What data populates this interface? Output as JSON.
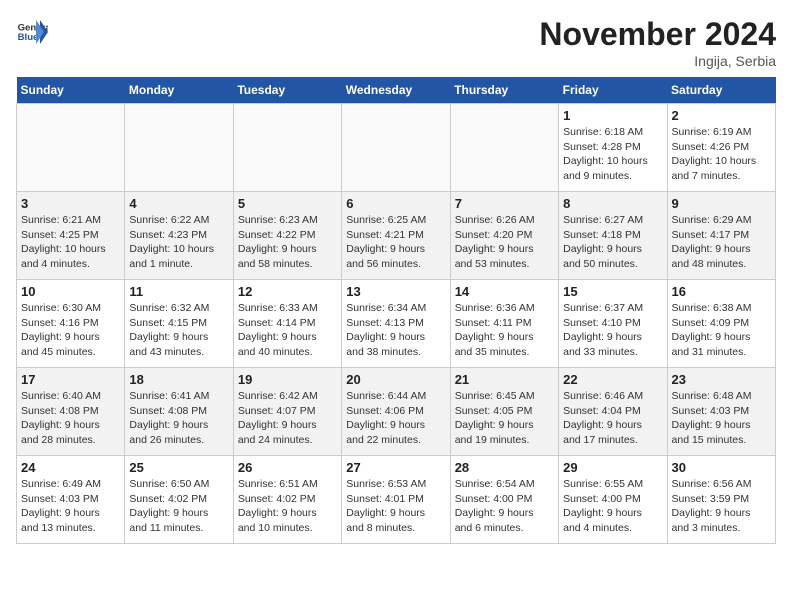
{
  "logo": {
    "general": "General",
    "blue": "Blue"
  },
  "title": "November 2024",
  "subtitle": "Ingija, Serbia",
  "days_of_week": [
    "Sunday",
    "Monday",
    "Tuesday",
    "Wednesday",
    "Thursday",
    "Friday",
    "Saturday"
  ],
  "weeks": [
    [
      {
        "day": "",
        "info": ""
      },
      {
        "day": "",
        "info": ""
      },
      {
        "day": "",
        "info": ""
      },
      {
        "day": "",
        "info": ""
      },
      {
        "day": "",
        "info": ""
      },
      {
        "day": "1",
        "info": "Sunrise: 6:18 AM\nSunset: 4:28 PM\nDaylight: 10 hours\nand 9 minutes."
      },
      {
        "day": "2",
        "info": "Sunrise: 6:19 AM\nSunset: 4:26 PM\nDaylight: 10 hours\nand 7 minutes."
      }
    ],
    [
      {
        "day": "3",
        "info": "Sunrise: 6:21 AM\nSunset: 4:25 PM\nDaylight: 10 hours\nand 4 minutes."
      },
      {
        "day": "4",
        "info": "Sunrise: 6:22 AM\nSunset: 4:23 PM\nDaylight: 10 hours\nand 1 minute."
      },
      {
        "day": "5",
        "info": "Sunrise: 6:23 AM\nSunset: 4:22 PM\nDaylight: 9 hours\nand 58 minutes."
      },
      {
        "day": "6",
        "info": "Sunrise: 6:25 AM\nSunset: 4:21 PM\nDaylight: 9 hours\nand 56 minutes."
      },
      {
        "day": "7",
        "info": "Sunrise: 6:26 AM\nSunset: 4:20 PM\nDaylight: 9 hours\nand 53 minutes."
      },
      {
        "day": "8",
        "info": "Sunrise: 6:27 AM\nSunset: 4:18 PM\nDaylight: 9 hours\nand 50 minutes."
      },
      {
        "day": "9",
        "info": "Sunrise: 6:29 AM\nSunset: 4:17 PM\nDaylight: 9 hours\nand 48 minutes."
      }
    ],
    [
      {
        "day": "10",
        "info": "Sunrise: 6:30 AM\nSunset: 4:16 PM\nDaylight: 9 hours\nand 45 minutes."
      },
      {
        "day": "11",
        "info": "Sunrise: 6:32 AM\nSunset: 4:15 PM\nDaylight: 9 hours\nand 43 minutes."
      },
      {
        "day": "12",
        "info": "Sunrise: 6:33 AM\nSunset: 4:14 PM\nDaylight: 9 hours\nand 40 minutes."
      },
      {
        "day": "13",
        "info": "Sunrise: 6:34 AM\nSunset: 4:13 PM\nDaylight: 9 hours\nand 38 minutes."
      },
      {
        "day": "14",
        "info": "Sunrise: 6:36 AM\nSunset: 4:11 PM\nDaylight: 9 hours\nand 35 minutes."
      },
      {
        "day": "15",
        "info": "Sunrise: 6:37 AM\nSunset: 4:10 PM\nDaylight: 9 hours\nand 33 minutes."
      },
      {
        "day": "16",
        "info": "Sunrise: 6:38 AM\nSunset: 4:09 PM\nDaylight: 9 hours\nand 31 minutes."
      }
    ],
    [
      {
        "day": "17",
        "info": "Sunrise: 6:40 AM\nSunset: 4:08 PM\nDaylight: 9 hours\nand 28 minutes."
      },
      {
        "day": "18",
        "info": "Sunrise: 6:41 AM\nSunset: 4:08 PM\nDaylight: 9 hours\nand 26 minutes."
      },
      {
        "day": "19",
        "info": "Sunrise: 6:42 AM\nSunset: 4:07 PM\nDaylight: 9 hours\nand 24 minutes."
      },
      {
        "day": "20",
        "info": "Sunrise: 6:44 AM\nSunset: 4:06 PM\nDaylight: 9 hours\nand 22 minutes."
      },
      {
        "day": "21",
        "info": "Sunrise: 6:45 AM\nSunset: 4:05 PM\nDaylight: 9 hours\nand 19 minutes."
      },
      {
        "day": "22",
        "info": "Sunrise: 6:46 AM\nSunset: 4:04 PM\nDaylight: 9 hours\nand 17 minutes."
      },
      {
        "day": "23",
        "info": "Sunrise: 6:48 AM\nSunset: 4:03 PM\nDaylight: 9 hours\nand 15 minutes."
      }
    ],
    [
      {
        "day": "24",
        "info": "Sunrise: 6:49 AM\nSunset: 4:03 PM\nDaylight: 9 hours\nand 13 minutes."
      },
      {
        "day": "25",
        "info": "Sunrise: 6:50 AM\nSunset: 4:02 PM\nDaylight: 9 hours\nand 11 minutes."
      },
      {
        "day": "26",
        "info": "Sunrise: 6:51 AM\nSunset: 4:02 PM\nDaylight: 9 hours\nand 10 minutes."
      },
      {
        "day": "27",
        "info": "Sunrise: 6:53 AM\nSunset: 4:01 PM\nDaylight: 9 hours\nand 8 minutes."
      },
      {
        "day": "28",
        "info": "Sunrise: 6:54 AM\nSunset: 4:00 PM\nDaylight: 9 hours\nand 6 minutes."
      },
      {
        "day": "29",
        "info": "Sunrise: 6:55 AM\nSunset: 4:00 PM\nDaylight: 9 hours\nand 4 minutes."
      },
      {
        "day": "30",
        "info": "Sunrise: 6:56 AM\nSunset: 3:59 PM\nDaylight: 9 hours\nand 3 minutes."
      }
    ]
  ]
}
